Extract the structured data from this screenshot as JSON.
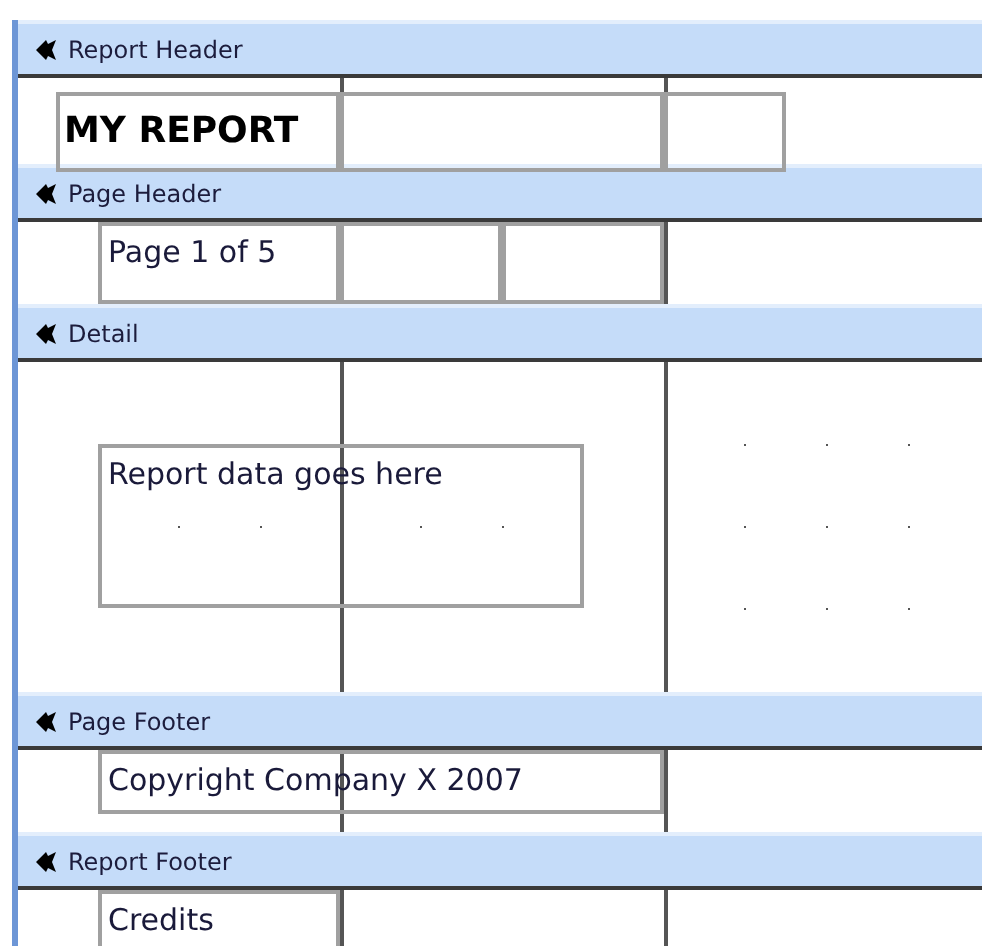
{
  "sections": [
    {
      "title": "Report Header",
      "controls": [
        {
          "text": "MY REPORT"
        }
      ]
    },
    {
      "title": "Page Header",
      "controls": [
        {
          "text": "Page 1 of 5"
        }
      ]
    },
    {
      "title": "Detail",
      "controls": [
        {
          "text": "Report data goes here"
        }
      ]
    },
    {
      "title": "Page Footer",
      "controls": [
        {
          "text": "Copyright Company X 2007"
        }
      ]
    },
    {
      "title": "Report Footer",
      "controls": [
        {
          "text": "Credits"
        }
      ]
    }
  ]
}
